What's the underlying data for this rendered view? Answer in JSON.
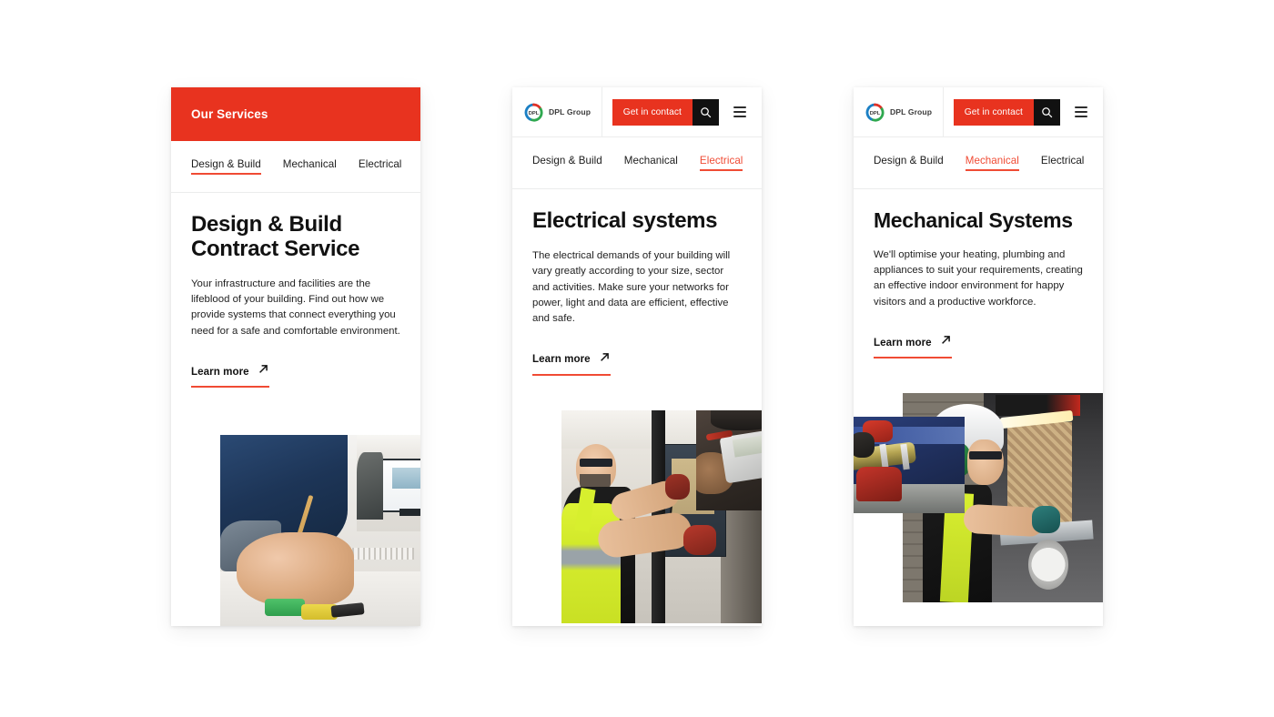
{
  "theme": {
    "brand_red": "#E8331F",
    "accent_red": "#F04B34",
    "ink": "#111111",
    "page_background": "#FFFFFF"
  },
  "cards": [
    {
      "id": "design-build",
      "banner": {
        "label": "Our Services"
      },
      "tabs": [
        {
          "label": "Design & Build",
          "active": true,
          "red_text": false
        },
        {
          "label": "Mechanical",
          "active": false,
          "red_text": false
        },
        {
          "label": "Electrical",
          "active": false,
          "red_text": false
        }
      ],
      "headline": "Design & Build Contract Service",
      "blurb": "Your infrastructure and facilities are the lifeblood of your building. Find out how we provide systems that connect everything you need for a safe and comfortable environment.",
      "cta": {
        "label": "Learn more",
        "icon": "arrow-up-right-icon"
      },
      "photos": {
        "main_alt": "engineer sketching plans at a desk",
        "inset_alt": "CAD drawing on a computer monitor"
      }
    },
    {
      "id": "electrical",
      "header": {
        "logo_text": "DPL Group",
        "logo_mark_text": "DPL",
        "contact_label": "Get in contact",
        "search_icon": "search-icon",
        "menu_icon": "hamburger-menu-icon"
      },
      "tabs": [
        {
          "label": "Design & Build",
          "active": false,
          "red_text": false
        },
        {
          "label": "Mechanical",
          "active": false,
          "red_text": false
        },
        {
          "label": "Electrical",
          "active": true,
          "red_text": true
        }
      ],
      "headline": "Electrical systems",
      "blurb": "The electrical demands of your building will vary greatly according to your size, sector and activities. Make sure your networks for power, light and data are efficient, effective and safe.",
      "cta": {
        "label": "Learn more",
        "icon": "arrow-up-right-icon"
      },
      "photos": {
        "main_alt": "electrician in hi-vis working on a wall panel",
        "inset_alt": "gloved hands holding a clamp multimeter"
      }
    },
    {
      "id": "mechanical",
      "header": {
        "logo_text": "DPL Group",
        "logo_mark_text": "DPL",
        "contact_label": "Get in contact",
        "search_icon": "search-icon",
        "menu_icon": "hamburger-menu-icon"
      },
      "tabs": [
        {
          "label": "Design & Build",
          "active": false,
          "red_text": false
        },
        {
          "label": "Mechanical",
          "active": true,
          "red_text": true
        },
        {
          "label": "Electrical",
          "active": false,
          "red_text": false
        }
      ],
      "headline": "Mechanical Systems",
      "blurb": "We'll optimise your heating, plumbing and appliances to suit your requirements, creating an effective indoor environment for happy visitors and a productive workforce.",
      "cta": {
        "label": "Learn more",
        "icon": "arrow-up-right-icon"
      },
      "photos": {
        "main_alt": "fabricator in hard hat cutting metal",
        "inset_alt": "copper pipe clamped in a red pipe vise"
      }
    }
  ]
}
